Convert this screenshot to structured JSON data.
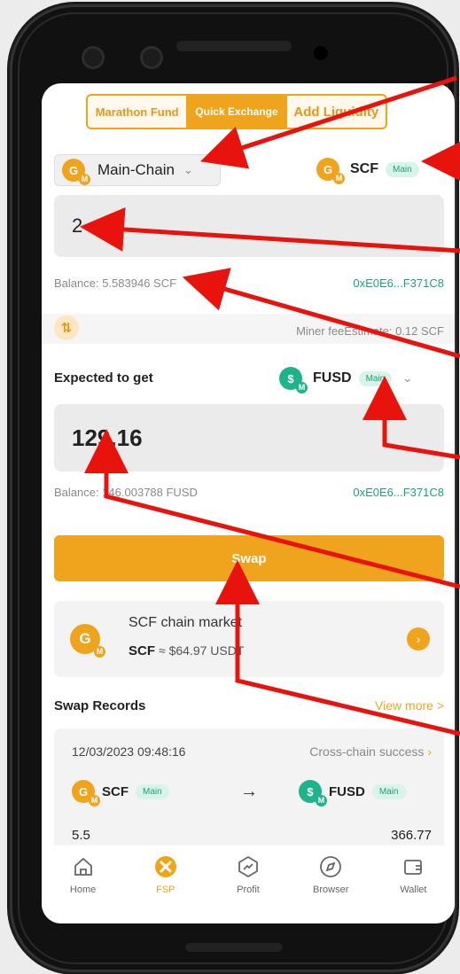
{
  "tabs": [
    {
      "label": "Marathon Fund",
      "active": false
    },
    {
      "label": "Quick Exchange",
      "active": true
    },
    {
      "label": "Add Liquidity",
      "active": false
    }
  ],
  "from": {
    "chain_label": "Main-Chain",
    "token": "SCF",
    "network_badge": "Main",
    "amount": "2",
    "balance": "Balance: 5.583946 SCF",
    "address": "0xE0E6...F371C8"
  },
  "fee": {
    "text": "Miner feeEstimate: 0.12 SCF"
  },
  "to": {
    "section_label": "Expected to get",
    "token": "FUSD",
    "network_badge": "Main",
    "amount": "129.16",
    "balance": "Balance: 146.003788 FUSD",
    "address": "0xE0E6...F371C8"
  },
  "swap_button": "Swap",
  "market": {
    "title": "SCF chain market",
    "token": "SCF",
    "price": "≈ $64.97 USDT"
  },
  "records": {
    "title": "Swap Records",
    "view_more": "View more >",
    "items": [
      {
        "time": "12/03/2023 09:48:16",
        "status": "Cross-chain success",
        "from_token": "SCF",
        "from_badge": "Main",
        "to_token": "FUSD",
        "to_badge": "Main",
        "from_amount": "5.5",
        "to_amount": "366.77"
      }
    ]
  },
  "nav": [
    {
      "label": "Home",
      "icon": "home-icon",
      "active": false
    },
    {
      "label": "FSP",
      "icon": "fsp-icon",
      "active": true
    },
    {
      "label": "Profit",
      "icon": "profit-icon",
      "active": false
    },
    {
      "label": "Browser",
      "icon": "compass-icon",
      "active": false
    },
    {
      "label": "Wallet",
      "icon": "wallet-icon",
      "active": false
    }
  ],
  "colors": {
    "accent": "#f0a41e",
    "green": "#1aa37a",
    "annotation_arrow": "#e8130c"
  }
}
